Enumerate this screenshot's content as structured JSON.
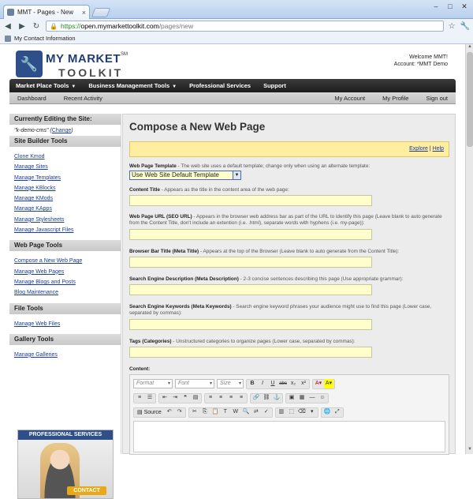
{
  "browser": {
    "tab_title": "MMT - Pages - New",
    "tab_close": "×",
    "url_https": "https://",
    "url_host": "open.mymarkettoolkit.com",
    "url_path": "/pages/new",
    "bookmark": "My Contact Information",
    "back_icon": "◀",
    "forward_icon": "▶",
    "reload_icon": "↻",
    "lock_icon": "🔒",
    "star_icon": "☆",
    "wrench_icon": "🔧",
    "minimize_icon": "–",
    "maximize_icon": "□",
    "close_icon": "✕"
  },
  "logo": {
    "line1": "MY MARKET",
    "line2": "TOOLKIT",
    "sm": "SM",
    "icon": "🔧"
  },
  "welcome": {
    "line1": "Welcome MMT!",
    "line2": "Account: *MMT Demo"
  },
  "mainnav": {
    "items": [
      {
        "label": "Market Place Tools",
        "caret": "▼"
      },
      {
        "label": "Business Management Tools",
        "caret": "▼"
      },
      {
        "label": "Professional Services"
      },
      {
        "label": "Support"
      }
    ]
  },
  "subnav": {
    "left": [
      "Dashboard",
      "Recent Activity"
    ],
    "right": [
      "My Account",
      "My Profile",
      "Sign out"
    ]
  },
  "sidebar": {
    "editing_header": "Currently Editing the Site:",
    "site_name": "\"k-demo-cms\"",
    "change_open": " (",
    "change": "Change",
    "change_close": ")",
    "site_builder_header": "Site Builder Tools",
    "site_builder_items": [
      "Clone Kmod",
      "Manage Sites",
      "Manage Templates",
      "Manage KBlocks",
      "Manage KMods",
      "Manage KApps",
      "Manage Stylesheets",
      "Manage Javascript Files"
    ],
    "web_page_header": "Web Page Tools",
    "web_page_items": [
      "Compose a New Web Page",
      "Manage Web Pages",
      "Manage Blogs and Posts",
      "Blog Maintenance"
    ],
    "file_header": "File Tools",
    "file_items": [
      "Manage Web Files"
    ],
    "gallery_header": "Gallery Tools",
    "gallery_items": [
      "Manage Galleries"
    ],
    "promo_title": "PROFESSIONAL SERVICES",
    "promo_button": "CONTACT"
  },
  "content": {
    "title": "Compose a New Web Page",
    "explore": "Explore",
    "sep": " | ",
    "help": "Help",
    "template_label": "Web Page Template",
    "template_desc": " - The web site uses a default template; change only when using an alternate template:",
    "template_value": "Use Web Site Default Template",
    "title_label": "Content Title",
    "title_desc": " - Appears as the title in the content area of the web page:",
    "url_label": "Web Page URL (SEO URL)",
    "url_desc": " - Appears in the browser web address bar as part of the URL to identify this page (Leave blank to auto generate from the Content Title, don't include an extention (i.e. .html), separate words with hyphens (i.e. my-page)):",
    "meta_label": "Browser Bar Title (Meta Title)",
    "meta_desc": " - Appears at the top of the Browser (Leave blank to auto generate from the Content Title):",
    "desc_label": "Search Engine Description (Meta Description)",
    "desc_desc": " - 2-3 concise sentences describing this page (Use appropriate grammar):",
    "kw_label": "Search Engine Keywords (Meta Keywords)",
    "kw_desc": " - Search engine keyword phrases your audience might use to find this page (Lower case, separated by commas):",
    "tags_label": "Tags (Categories)",
    "tags_desc": " - Unstructured categories to organize pages (Lower case, separated by commas):",
    "content_label": "Content:"
  },
  "editor": {
    "format": "Format",
    "font": "Font",
    "size": "Size",
    "bold": "B",
    "italic": "I",
    "underline": "U",
    "strike": "abc",
    "sub": "x₂",
    "sup": "x²",
    "source": "Source"
  }
}
